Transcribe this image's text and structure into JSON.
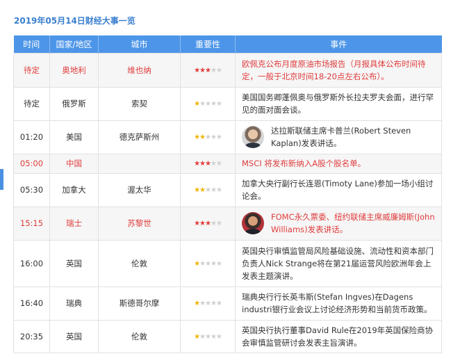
{
  "title": "2019年05月14日财经大事一览",
  "headers": {
    "time": "时间",
    "country": "国家/地区",
    "city": "城市",
    "importance": "重要性",
    "event": "事件"
  },
  "colors": {
    "header_bg": "#4d95e8",
    "title": "#3a7fcf",
    "highlight_text": "#e03c3c",
    "star_high": "#e23b3b",
    "star_low": "#f0b400",
    "star_off": "#cfcfcf"
  },
  "rows": [
    {
      "time": "待定",
      "country": "奥地利",
      "city": "维也纳",
      "importance": 3,
      "highlight": true,
      "avatar": null,
      "event": "欧佩克公布月度原油市场报告（月报具体公布时间待定，一般于北京时间18-20点左右公布）。"
    },
    {
      "time": "待定",
      "country": "俄罗斯",
      "city": "索契",
      "importance": 1,
      "highlight": false,
      "avatar": null,
      "event": "美国国务卿蓬佩奥与俄罗斯外长拉夫罗夫会面，进行罕见的面对面会谈。"
    },
    {
      "time": "01:20",
      "country": "美国",
      "city": "德克萨斯州",
      "importance": 2,
      "highlight": false,
      "avatar": "kaplan",
      "event": "达拉斯联储主席卡普兰(Robert Steven Kaplan)发表讲话。"
    },
    {
      "time": "05:00",
      "country": "中国",
      "city": "",
      "importance": 3,
      "highlight": true,
      "avatar": null,
      "event": "MSCI 将发布新纳入A股个股名单。"
    },
    {
      "time": "05:30",
      "country": "加拿大",
      "city": "渥太华",
      "importance": 2,
      "highlight": false,
      "avatar": null,
      "event": "加拿大央行副行长连恩(Timoty Lane)参加一场小组讨论会。"
    },
    {
      "time": "15:15",
      "country": "瑞士",
      "city": "苏黎世",
      "importance": 3,
      "highlight": true,
      "avatar": "williams",
      "event": "FOMC永久票委、纽约联储主席威廉姆斯(John Williams)发表讲话。"
    },
    {
      "time": "16:00",
      "country": "英国",
      "city": "伦敦",
      "importance": 1,
      "highlight": false,
      "avatar": null,
      "event": "英国央行审慎监管局风险基础设施、流动性和资本部门负责人Nick Strange将在第21届运营风险欧洲年会上发表主题演讲。"
    },
    {
      "time": "16:40",
      "country": "瑞典",
      "city": "斯德哥尔摩",
      "importance": 1,
      "highlight": false,
      "avatar": null,
      "event": "瑞典央行行长英韦斯(Stefan Ingves)在Dagens industri银行业会议上讨论经济形势和当前货币政策。"
    },
    {
      "time": "20:35",
      "country": "英国",
      "city": "伦敦",
      "importance": 1,
      "highlight": false,
      "avatar": null,
      "event": "英国央行执行董事David Rule在2019年英国保险商协会审慎监管研讨会发表主旨演讲。"
    }
  ]
}
